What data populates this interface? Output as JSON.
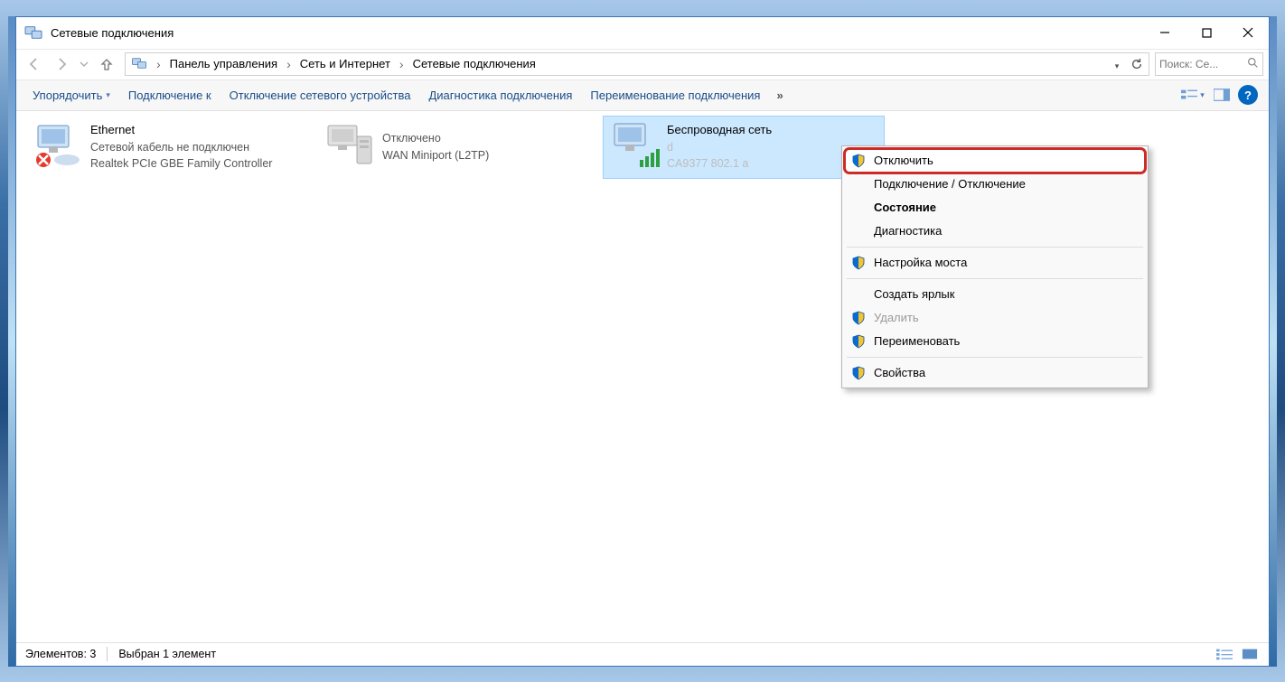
{
  "window": {
    "title": "Сетевые подключения"
  },
  "breadcrumb": {
    "items": [
      "Панель управления",
      "Сеть и Интернет",
      "Сетевые подключения"
    ]
  },
  "search": {
    "placeholder": "Поиск: Се..."
  },
  "toolbar": {
    "items": [
      "Упорядочить",
      "Подключение к",
      "Отключение сетевого устройства",
      "Диагностика подключения",
      "Переименование подключения"
    ],
    "overflow": "»"
  },
  "adapters": [
    {
      "name": "Ethernet",
      "status": "Сетевой кабель не подключен",
      "device": "Realtek PCIe GBE Family Controller",
      "state": "disconnected"
    },
    {
      "name": " ",
      "status": "Отключено",
      "device": "WAN Miniport (L2TP)",
      "state": "disabled"
    },
    {
      "name": "Беспроводная сеть",
      "status": "d",
      "device": "CA9377 802.1  a",
      "state": "connected",
      "selected": true
    }
  ],
  "context_menu": {
    "items": [
      {
        "label": "Отключить",
        "shield": true,
        "highlight": true
      },
      {
        "label": "Подключение / Отключение"
      },
      {
        "label": "Состояние",
        "bold": true
      },
      {
        "label": "Диагностика"
      },
      {
        "sep": true
      },
      {
        "label": "Настройка моста",
        "shield": true
      },
      {
        "sep": true
      },
      {
        "label": "Создать ярлык"
      },
      {
        "label": "Удалить",
        "shield": true,
        "disabled": true
      },
      {
        "label": "Переименовать",
        "shield": true
      },
      {
        "sep": true
      },
      {
        "label": "Свойства",
        "shield": true
      }
    ]
  },
  "statusbar": {
    "elements_label": "Элементов: 3",
    "selection_label": "Выбран 1 элемент"
  }
}
